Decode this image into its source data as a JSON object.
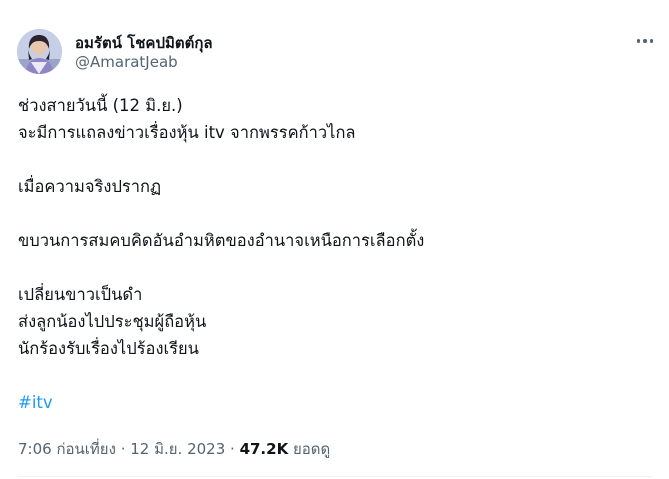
{
  "author": {
    "display_name": "อมรัตน์ โชคปมิตต์กุล",
    "handle": "@AmaratJeab",
    "avatar_icon": "profile-photo-icon"
  },
  "more_icon": "ellipsis-horizontal-icon",
  "tweet": {
    "lines": [
      "ช่วงสายวันนี้ (12 มิ.ย.)",
      "จะมีการแถลงข่าวเรื่องหุ้น itv จากพรรคก้าวไกล",
      "",
      "เมื่อความจริงปรากฏ",
      "",
      "ขบวนการสมคบคิดอันอำมหิตของอำนาจเหนือการเลือกตั้ง",
      "",
      "เปลี่ยนขาวเป็นดำ",
      "ส่งลูกน้องไปประชุมผู้ถือหุ้น",
      "นักร้องรับเรื่องไปร้องเรียน",
      ""
    ],
    "hashtag": "#itv"
  },
  "meta": {
    "timestamp": "7:06 ก่อนเที่ยง · 12 มิ.ย. 2023 ·",
    "views_count": "47.2K",
    "views_label": "ยอดดู"
  },
  "colors": {
    "text": "#0f1419",
    "secondary": "#536471",
    "link": "#1d9bf0",
    "divider": "#eff3f4"
  }
}
